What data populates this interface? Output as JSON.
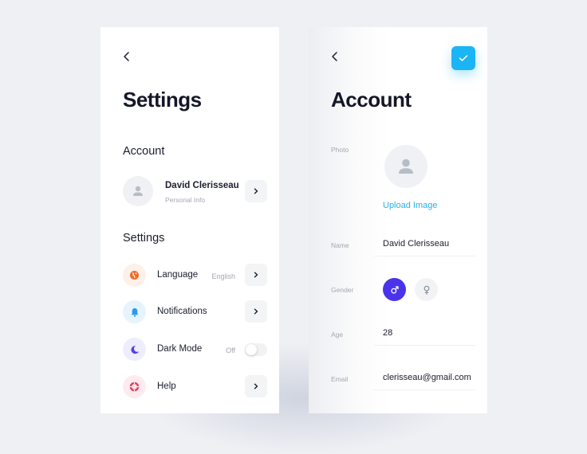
{
  "settings_screen": {
    "title": "Settings",
    "account_section": "Account",
    "profile": {
      "name": "David Clerisseau",
      "subtitle": "Personal Info"
    },
    "settings_section": "Settings",
    "items": [
      {
        "label": "Language",
        "value": "English",
        "icon": "globe-icon",
        "icon_color": "#ef6a2a",
        "icon_bg": "#fdf0e8"
      },
      {
        "label": "Notifications",
        "value": "",
        "icon": "bell-icon",
        "icon_color": "#2a9bf0",
        "icon_bg": "#e6f4fd"
      },
      {
        "label": "Dark Mode",
        "value": "Off",
        "icon": "moon-icon",
        "icon_color": "#5b3bef",
        "icon_bg": "#eeedfd",
        "toggle_on": false
      },
      {
        "label": "Help",
        "value": "",
        "icon": "lifebuoy-icon",
        "icon_color": "#e83a5b",
        "icon_bg": "#fdebef"
      }
    ]
  },
  "account_screen": {
    "title": "Account",
    "photo_label": "Photo",
    "upload_label": "Upload Image",
    "name_label": "Name",
    "name_value": "David Clerisseau",
    "gender_label": "Gender",
    "gender_male": "♂",
    "gender_female": "♀",
    "gender_selected": "male",
    "age_label": "Age",
    "age_value": "28",
    "email_label": "Email",
    "email_value": "clerisseau@gmail.com"
  },
  "colors": {
    "accent": "#1bb4f5",
    "male_selected": "#4a33ea",
    "link": "#27b0e6"
  }
}
